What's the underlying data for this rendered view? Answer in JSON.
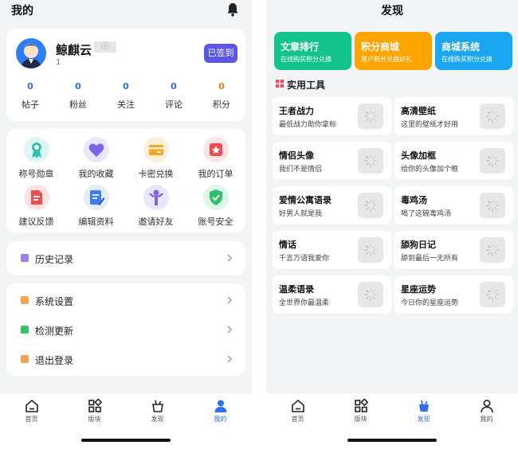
{
  "left": {
    "header_title": "我的",
    "profile": {
      "name": "鲸麒云",
      "badge": "ⓘ",
      "uid": "1",
      "sign_button": "已签到"
    },
    "stats": [
      {
        "value": "0",
        "label": "帖子"
      },
      {
        "value": "0",
        "label": "粉丝"
      },
      {
        "value": "0",
        "label": "关注"
      },
      {
        "value": "0",
        "label": "评论"
      },
      {
        "value": "0",
        "label": "积分"
      }
    ],
    "features": [
      {
        "label": "称号勋章",
        "icon": "medal-icon"
      },
      {
        "label": "我的收藏",
        "icon": "heart-icon"
      },
      {
        "label": "卡密兑换",
        "icon": "card-icon"
      },
      {
        "label": "我的订单",
        "icon": "order-icon"
      },
      {
        "label": "建议反馈",
        "icon": "feedback-icon"
      },
      {
        "label": "编辑资料",
        "icon": "edit-icon"
      },
      {
        "label": "邀请好友",
        "icon": "invite-icon"
      },
      {
        "label": "账号安全",
        "icon": "shield-icon"
      }
    ],
    "history": {
      "label": "历史记录"
    },
    "settings": [
      {
        "label": "系统设置"
      },
      {
        "label": "检测更新"
      },
      {
        "label": "退出登录"
      }
    ]
  },
  "right": {
    "header_title": "发现",
    "promos": [
      {
        "title": "文章排行",
        "subtitle": "在线购买积分兑换",
        "color": "#12c48b"
      },
      {
        "title": "积分商城",
        "subtitle": "用户积分兑换好礼",
        "color": "#ffa502"
      },
      {
        "title": "商城系统",
        "subtitle": "在线购买积分兑换",
        "color": "#1aa6f0"
      }
    ],
    "section_title": "实用工具",
    "tools": [
      {
        "title": "王者战力",
        "subtitle": "最低战力助你拿标"
      },
      {
        "title": "高清壁纸",
        "subtitle": "这里的壁纸才好用"
      },
      {
        "title": "情侣头像",
        "subtitle": "我们不是情侣"
      },
      {
        "title": "头像加框",
        "subtitle": "给你的头像加个框"
      },
      {
        "title": "爱情公寓语录",
        "subtitle": "好男人就是我"
      },
      {
        "title": "毒鸡汤",
        "subtitle": "喝了这碗毒鸡汤"
      },
      {
        "title": "情话",
        "subtitle": "千言万语我爱你"
      },
      {
        "title": "舔狗日记",
        "subtitle": "舔到最后一无所有"
      },
      {
        "title": "温柔语录",
        "subtitle": "全世界你最温柔"
      },
      {
        "title": "星座运势",
        "subtitle": "今日你的星座运势"
      }
    ]
  },
  "tabbar": [
    {
      "label": "首页",
      "icon": "home-icon"
    },
    {
      "label": "版块",
      "icon": "blocks-icon"
    },
    {
      "label": "发现",
      "icon": "discover-icon"
    },
    {
      "label": "我的",
      "icon": "user-icon"
    }
  ],
  "colors": {
    "accent": "#2e6ff2",
    "sign_button": "#5b56e6",
    "points": "#f07b1d"
  }
}
